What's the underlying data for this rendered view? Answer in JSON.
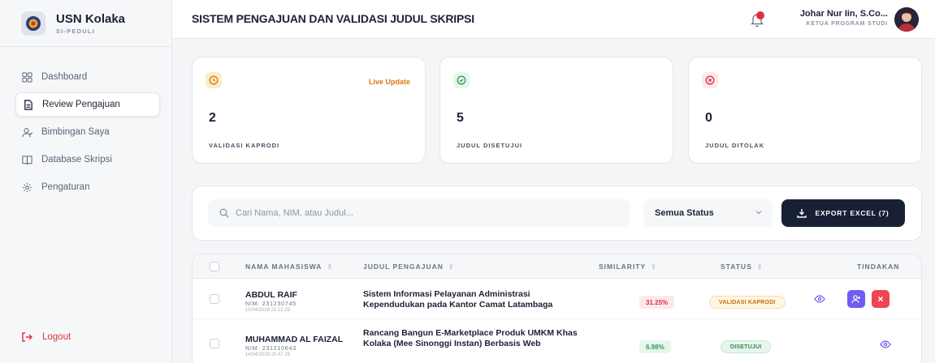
{
  "brand": {
    "name": "USN Kolaka",
    "subtitle": "SI-PEDULI"
  },
  "sidebar": {
    "items": [
      {
        "label": "Dashboard",
        "icon": "grid-icon",
        "active": false
      },
      {
        "label": "Review Pengajuan",
        "icon": "document-icon",
        "active": true
      },
      {
        "label": "Bimbingan Saya",
        "icon": "user-icon",
        "active": false
      },
      {
        "label": "Database Skripsi",
        "icon": "book-icon",
        "active": false
      },
      {
        "label": "Pengaturan",
        "icon": "gear-icon",
        "active": false
      }
    ],
    "logout_label": "Logout"
  },
  "header": {
    "title": "SISTEM PENGAJUAN DAN VALIDASI JUDUL SKRIPSI",
    "user_name": "Johar Nur Iin, S.Co...",
    "user_role": "KETUA PROGRAM STUDI"
  },
  "stats": [
    {
      "value": "2",
      "label": "VALIDASI KAPRODI",
      "badge": "Live Update",
      "icon": "clock-icon",
      "color": "#d97a12"
    },
    {
      "value": "5",
      "label": "JUDUL DISETUJUI",
      "icon": "check-circle-icon",
      "color": "#2f9a55"
    },
    {
      "value": "0",
      "label": "JUDUL DITOLAK",
      "icon": "x-circle-icon",
      "color": "#e0313b"
    }
  ],
  "filter": {
    "search_placeholder": "Cari Nama, NIM, atau Judul...",
    "status_selected": "Semua Status",
    "export_label": "EXPORT EXCEL (7)"
  },
  "table": {
    "headers": [
      "NAMA MAHASISWA",
      "JUDUL PENGAJUAN",
      "SIMILARITY",
      "STATUS",
      "TINDAKAN"
    ],
    "rows": [
      {
        "name": "ABDUL RAIF",
        "nim": "NIM: 231230745",
        "date": "15/04/2026 22.22.29",
        "judul": "Sistem Informasi Pelayanan Administrasi Kependudukan pada Kantor Camat Latambaga",
        "similarity": "31.25%",
        "status": "VALIDASI KAPRODI"
      },
      {
        "name": "MUHAMMAD AL FAIZAL",
        "nim": "NIM: 231210643",
        "date": "14/04/2026 20.47.26",
        "judul": "Rancang Bangun E-Marketplace Produk UMKM Khas Kolaka (Mee Sinonggi Instan) Berbasis Web",
        "similarity": "6.98%",
        "status": "DISETUJUI"
      }
    ]
  },
  "colors": {
    "accent_dark": "#182035",
    "danger": "#e0313b",
    "assign": "#6d5cf6",
    "warning": "#d97a12",
    "success": "#2f9a55"
  }
}
